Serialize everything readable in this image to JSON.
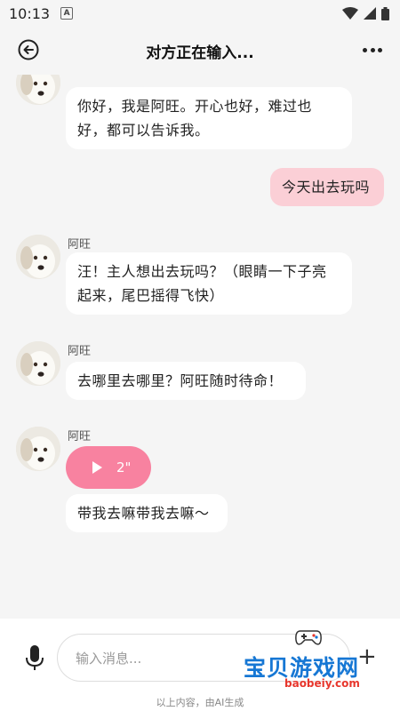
{
  "status_bar": {
    "time": "10:13",
    "indicator": "A"
  },
  "header": {
    "title": "对方正在输入..."
  },
  "messages": [
    {
      "sender": "",
      "text": "你好，我是阿旺。开心也好，难过也好，都可以告诉我。"
    },
    {
      "sender": "me",
      "text": "今天出去玩吗"
    },
    {
      "sender": "阿旺",
      "text": "汪！主人想出去玩吗？（眼睛一下子亮起来，尾巴摇得飞快）"
    },
    {
      "sender": "阿旺",
      "text": "去哪里去哪里？阿旺随时待命！"
    },
    {
      "sender": "阿旺",
      "voice_duration": "2\"",
      "text": "带我去嘛带我去嘛～"
    }
  ],
  "input": {
    "placeholder": "输入消息..."
  },
  "footnote": "以上内容，由AI生成",
  "watermark": {
    "text": "宝贝游戏网",
    "url": "baobeiy.com"
  },
  "colors": {
    "my_bubble": "#fbcfd6",
    "voice_bubble": "#f882a0",
    "background": "#f5f5f5"
  },
  "icons": [
    "back-arrow-icon",
    "more-dots-icon",
    "play-icon",
    "mic-icon",
    "plus-icon",
    "wifi-icon",
    "signal-icon",
    "battery-icon"
  ]
}
